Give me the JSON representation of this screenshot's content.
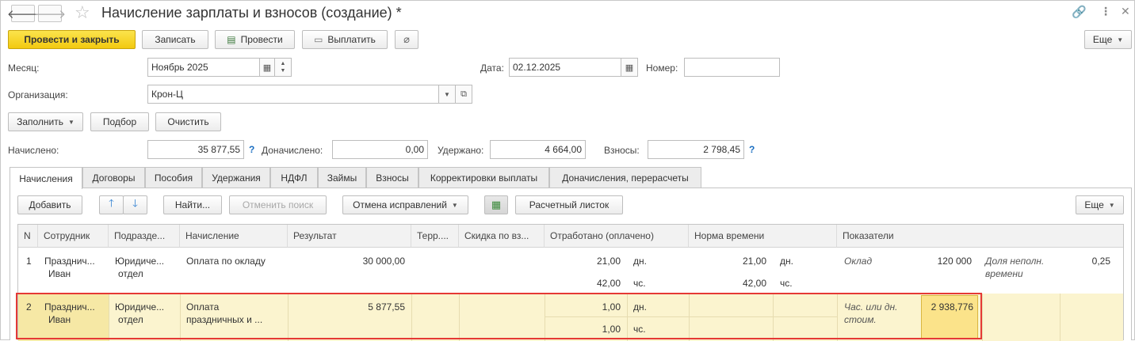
{
  "window": {
    "title": "Начисление зарплаты и взносов (создание) *"
  },
  "toolbar": {
    "post_close": "Провести и закрыть",
    "save": "Записать",
    "post": "Провести",
    "pay": "Выплатить",
    "more": "Еще"
  },
  "form": {
    "month_label": "Месяц:",
    "month_value": "Ноябрь 2025",
    "date_label": "Дата:",
    "date_value": "02.12.2025",
    "number_label": "Номер:",
    "number_value": "",
    "org_label": "Организация:",
    "org_value": "Крон-Ц",
    "fill_btn": "Заполнить",
    "select_btn": "Подбор",
    "clear_btn": "Очистить"
  },
  "totals": {
    "accrued_label": "Начислено:",
    "accrued_value": "35 877,55",
    "extra_label": "Доначислено:",
    "extra_value": "0,00",
    "withheld_label": "Удержано:",
    "withheld_value": "4 664,00",
    "contrib_label": "Взносы:",
    "contrib_value": "2 798,45",
    "help": "?"
  },
  "tabs": [
    "Начисления",
    "Договоры",
    "Пособия",
    "Удержания",
    "НДФЛ",
    "Займы",
    "Взносы",
    "Корректировки выплаты",
    "Доначисления, перерасчеты"
  ],
  "panel_toolbar": {
    "add": "Добавить",
    "find": "Найти...",
    "cancel_search": "Отменить поиск",
    "undo_corrections": "Отмена исправлений",
    "payslip": "Расчетный листок",
    "more": "Еще"
  },
  "table": {
    "headers": [
      "N",
      "Сотрудник",
      "Подразде...",
      "Начисление",
      "Результат",
      "Терр....",
      "Скидка по вз...",
      "Отработано (оплачено)",
      "Норма времени",
      "Показатели"
    ],
    "rows": [
      {
        "n": "1",
        "employee_1": "Празднич...",
        "employee_2": "Иван",
        "dept_1": "Юридиче...",
        "dept_2": "отдел",
        "accrual_1": "Оплата по окладу",
        "accrual_2": "",
        "result": "30 000,00",
        "worked_days": "21,00",
        "worked_days_unit": "дн.",
        "worked_hours": "42,00",
        "worked_hours_unit": "чс.",
        "norm_days": "21,00",
        "norm_days_unit": "дн.",
        "norm_hours": "42,00",
        "norm_hours_unit": "чс.",
        "ind1_name": "Оклад",
        "ind1_name_2": "",
        "ind1_value": "120 000",
        "ind2_name_1": "Доля неполн.",
        "ind2_name_2": "времени",
        "ind2_value": "0,25"
      },
      {
        "n": "2",
        "employee_1": "Празднич...",
        "employee_2": "Иван",
        "dept_1": "Юридиче...",
        "dept_2": "отдел",
        "accrual_1": "Оплата",
        "accrual_2": "праздничных и ...",
        "result": "5 877,55",
        "worked_days": "1,00",
        "worked_days_unit": "дн.",
        "worked_hours": "1,00",
        "worked_hours_unit": "чс.",
        "ind1_name": "Час. или дн.",
        "ind1_name_2": "стоим.",
        "ind1_value": "2 938,776"
      }
    ]
  },
  "colors": {
    "primary_button": "#f2c90f",
    "selected_row": "#fbf4cf",
    "highlight_border": "#e53935"
  }
}
